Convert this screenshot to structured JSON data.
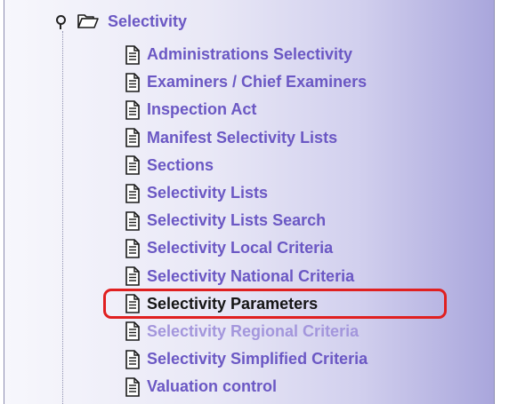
{
  "tree": {
    "root": {
      "label": "Selectivity",
      "expander_icon": "tree-expanded-icon",
      "folder_icon": "folder-open-icon"
    },
    "children": [
      {
        "label": "Administrations Selectivity",
        "icon": "document-icon",
        "state": "normal"
      },
      {
        "label": "Examiners / Chief Examiners",
        "icon": "document-icon",
        "state": "normal"
      },
      {
        "label": "Inspection Act",
        "icon": "document-icon",
        "state": "normal"
      },
      {
        "label": "Manifest Selectivity Lists",
        "icon": "document-icon",
        "state": "normal"
      },
      {
        "label": "Sections",
        "icon": "document-icon",
        "state": "normal"
      },
      {
        "label": "Selectivity Lists",
        "icon": "document-icon",
        "state": "normal"
      },
      {
        "label": "Selectivity Lists Search",
        "icon": "document-icon",
        "state": "normal"
      },
      {
        "label": "Selectivity Local Criteria",
        "icon": "document-icon",
        "state": "normal"
      },
      {
        "label": "Selectivity National Criteria",
        "icon": "document-icon",
        "state": "normal"
      },
      {
        "label": "Selectivity Parameters",
        "icon": "document-icon",
        "state": "selected",
        "annotation": "red-highlight-ring"
      },
      {
        "label": "Selectivity Regional Criteria",
        "icon": "document-icon",
        "state": "normal"
      },
      {
        "label": "Selectivity Simplified Criteria",
        "icon": "document-icon",
        "state": "normal"
      },
      {
        "label": "Valuation control",
        "icon": "document-icon",
        "state": "normal"
      }
    ]
  },
  "colors": {
    "link_text": "#6b58c4",
    "selected_text": "#151515",
    "highlight_ring": "#e02020",
    "panel_gradient_end": "#a9a6dc"
  }
}
